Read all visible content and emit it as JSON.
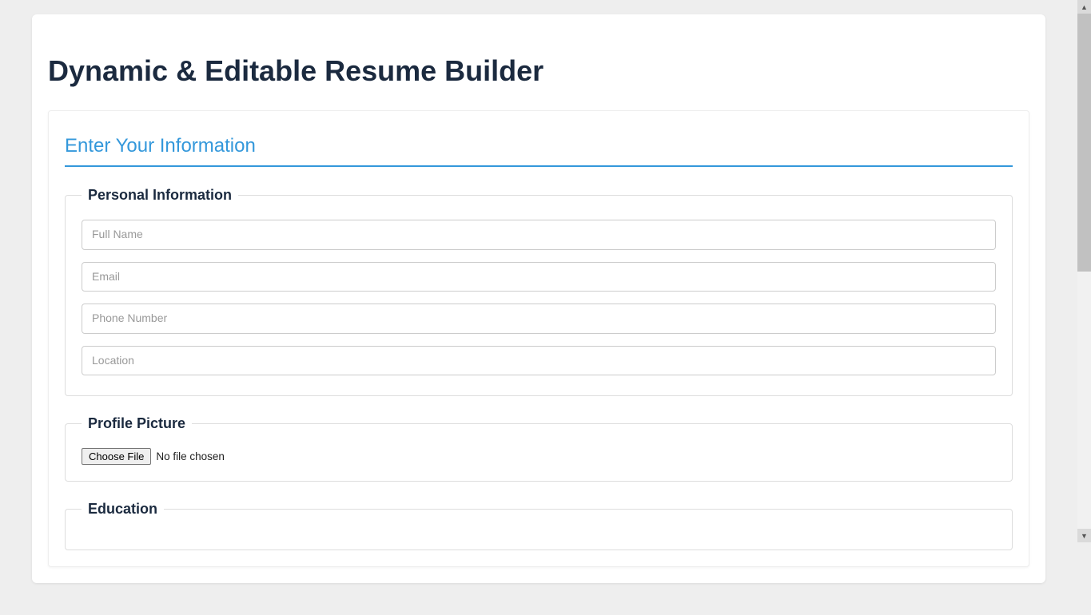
{
  "page_title": "Dynamic & Editable Resume Builder",
  "section_heading": "Enter Your Information",
  "personal": {
    "legend": "Personal Information",
    "full_name_placeholder": "Full Name",
    "email_placeholder": "Email",
    "phone_placeholder": "Phone Number",
    "location_placeholder": "Location"
  },
  "profile_picture": {
    "legend": "Profile Picture",
    "choose_file_label": "Choose File",
    "no_file_label": "No file chosen"
  },
  "education": {
    "legend": "Education"
  }
}
